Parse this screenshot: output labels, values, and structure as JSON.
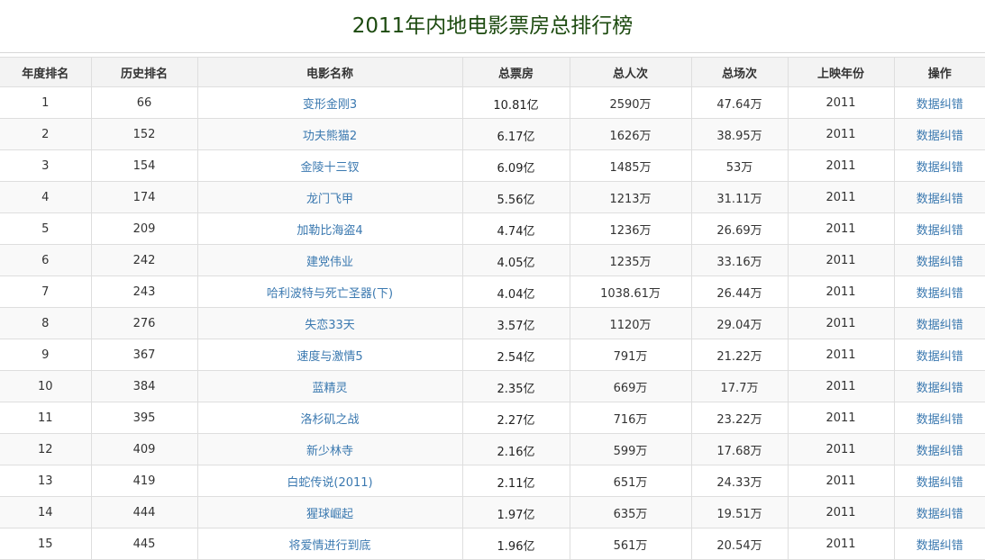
{
  "page": {
    "title": "2011年内地电影票房总排行榜"
  },
  "table": {
    "headers": [
      "年度排名",
      "历史排名",
      "电影名称",
      "总票房",
      "总人次",
      "总场次",
      "上映年份",
      "操作"
    ],
    "rows": [
      {
        "year_rank": "1",
        "hist_rank": "66",
        "name": "变形金刚3",
        "box": "10.81亿",
        "admissions": "2590万",
        "screenings": "47.64万",
        "year": "2011",
        "action": "数据纠错"
      },
      {
        "year_rank": "2",
        "hist_rank": "152",
        "name": "功夫熊猫2",
        "box": "6.17亿",
        "admissions": "1626万",
        "screenings": "38.95万",
        "year": "2011",
        "action": "数据纠错"
      },
      {
        "year_rank": "3",
        "hist_rank": "154",
        "name": "金陵十三钗",
        "box": "6.09亿",
        "admissions": "1485万",
        "screenings": "53万",
        "year": "2011",
        "action": "数据纠错"
      },
      {
        "year_rank": "4",
        "hist_rank": "174",
        "name": "龙门飞甲",
        "box": "5.56亿",
        "admissions": "1213万",
        "screenings": "31.11万",
        "year": "2011",
        "action": "数据纠错"
      },
      {
        "year_rank": "5",
        "hist_rank": "209",
        "name": "加勒比海盗4",
        "box": "4.74亿",
        "admissions": "1236万",
        "screenings": "26.69万",
        "year": "2011",
        "action": "数据纠错"
      },
      {
        "year_rank": "6",
        "hist_rank": "242",
        "name": "建党伟业",
        "box": "4.05亿",
        "admissions": "1235万",
        "screenings": "33.16万",
        "year": "2011",
        "action": "数据纠错"
      },
      {
        "year_rank": "7",
        "hist_rank": "243",
        "name": "哈利波特与死亡圣器(下)",
        "box": "4.04亿",
        "admissions": "1038.61万",
        "screenings": "26.44万",
        "year": "2011",
        "action": "数据纠错"
      },
      {
        "year_rank": "8",
        "hist_rank": "276",
        "name": "失恋33天",
        "box": "3.57亿",
        "admissions": "1120万",
        "screenings": "29.04万",
        "year": "2011",
        "action": "数据纠错"
      },
      {
        "year_rank": "9",
        "hist_rank": "367",
        "name": "速度与激情5",
        "box": "2.54亿",
        "admissions": "791万",
        "screenings": "21.22万",
        "year": "2011",
        "action": "数据纠错"
      },
      {
        "year_rank": "10",
        "hist_rank": "384",
        "name": "蓝精灵",
        "box": "2.35亿",
        "admissions": "669万",
        "screenings": "17.7万",
        "year": "2011",
        "action": "数据纠错"
      },
      {
        "year_rank": "11",
        "hist_rank": "395",
        "name": "洛杉矶之战",
        "box": "2.27亿",
        "admissions": "716万",
        "screenings": "23.22万",
        "year": "2011",
        "action": "数据纠错"
      },
      {
        "year_rank": "12",
        "hist_rank": "409",
        "name": "新少林寺",
        "box": "2.16亿",
        "admissions": "599万",
        "screenings": "17.68万",
        "year": "2011",
        "action": "数据纠错"
      },
      {
        "year_rank": "13",
        "hist_rank": "419",
        "name": "白蛇传说(2011)",
        "box": "2.11亿",
        "admissions": "651万",
        "screenings": "24.33万",
        "year": "2011",
        "action": "数据纠错"
      },
      {
        "year_rank": "14",
        "hist_rank": "444",
        "name": "猩球崛起",
        "box": "1.97亿",
        "admissions": "635万",
        "screenings": "19.51万",
        "year": "2011",
        "action": "数据纠错"
      },
      {
        "year_rank": "15",
        "hist_rank": "445",
        "name": "将爱情进行到底",
        "box": "1.96亿",
        "admissions": "561万",
        "screenings": "20.54万",
        "year": "2011",
        "action": "数据纠错"
      }
    ]
  }
}
